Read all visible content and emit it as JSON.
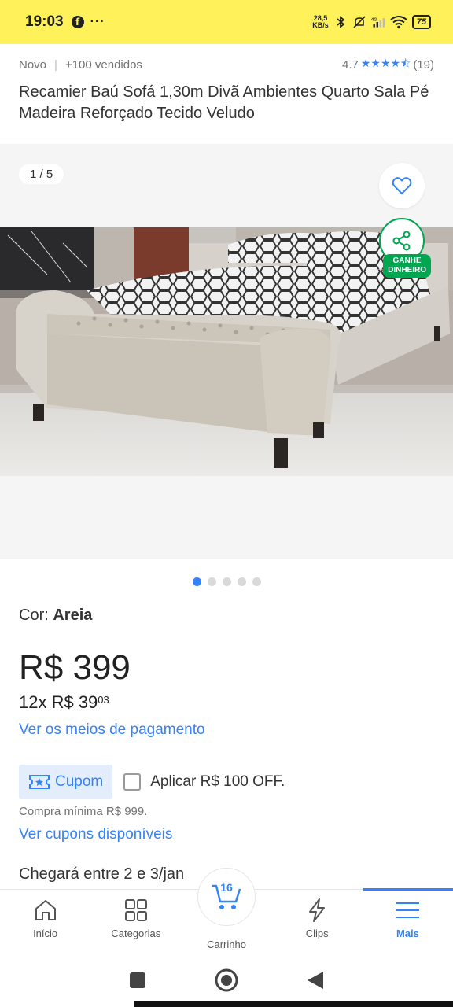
{
  "status_bar": {
    "time": "19:03",
    "speed_top": "28,5",
    "speed_bottom": "KB/s",
    "network": "4G",
    "battery": "75"
  },
  "product": {
    "condition": "Novo",
    "sold": "+100 vendidos",
    "rating": "4.7",
    "stars": "★★★★⯪",
    "reviews": "(19)",
    "title": "Recamier Baú Sofá 1,30m Divã Ambientes Quarto Sala Pé Madeira Reforçado Tecido Veludo"
  },
  "gallery": {
    "counter": "1 / 5",
    "earn_badge_line1": "GANHE",
    "earn_badge_line2": "DINHEIRO",
    "total_images": 5,
    "active_index": 0
  },
  "variant": {
    "label": "Cor:",
    "value": "Areia"
  },
  "pricing": {
    "price": "R$ 399",
    "installments_main": "12x R$ 39",
    "installments_cents": "03",
    "payment_link": "Ver os meios de pagamento"
  },
  "coupon": {
    "tag": "Cupom",
    "apply_label": "Aplicar R$ 100 OFF.",
    "applied": false,
    "min_purchase": "Compra mínima R$ 999.",
    "see_coupons": "Ver cupons disponíveis"
  },
  "delivery": {
    "arrival": "Chegará entre 2 e 3/jan"
  },
  "bottom_nav": {
    "items": [
      {
        "label": "Início",
        "icon": "home-icon"
      },
      {
        "label": "Categorias",
        "icon": "grid-icon"
      },
      {
        "label": "Carrinho",
        "icon": "cart-icon",
        "count": "16"
      },
      {
        "label": "Clips",
        "icon": "lightning-icon"
      },
      {
        "label": "Mais",
        "icon": "menu-icon",
        "active": true
      }
    ]
  },
  "colors": {
    "brand_yellow": "#fff159",
    "accent_blue": "#3483fa",
    "success_green": "#00a650"
  }
}
